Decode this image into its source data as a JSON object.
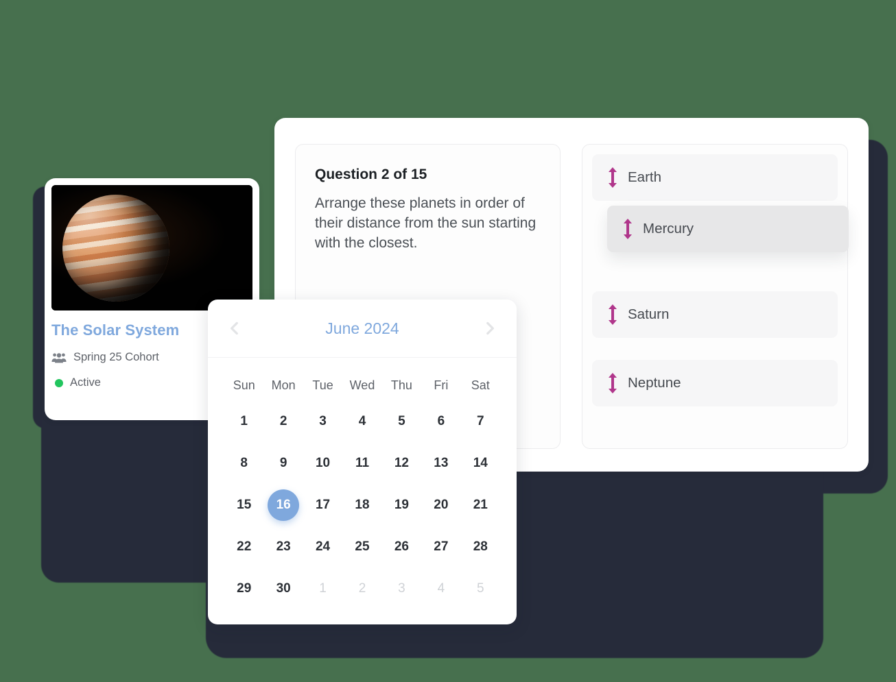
{
  "background": {
    "page_color": "#47704e",
    "shadow_color": "#262b3a"
  },
  "course_card": {
    "title": "The Solar System",
    "cohort_icon": "users-icon",
    "cohort": "Spring 25 Cohort",
    "status_icon": "status-dot-icon",
    "status": "Active",
    "status_color": "#22c55e",
    "title_color": "#7fa8dd",
    "thumbnail_alt": "Jupiter planet on black background"
  },
  "quiz_card": {
    "question_number": "Question 2 of 15",
    "question_text": "Arrange these planets in order of their distance from the sun starting with the closest.",
    "answers": [
      {
        "label": "Earth",
        "state": "idle",
        "handle_icon": "drag-handle-updown-icon"
      },
      {
        "label": "Mercury",
        "state": "dragging",
        "handle_icon": "drag-handle-updown-icon"
      },
      {
        "label": "Saturn",
        "state": "idle",
        "handle_icon": "drag-handle-updown-icon"
      },
      {
        "label": "Neptune",
        "state": "idle",
        "handle_icon": "drag-handle-updown-icon"
      }
    ],
    "handle_color": "#b0368b"
  },
  "calendar": {
    "prev_icon": "chevron-left-icon",
    "next_icon": "chevron-right-icon",
    "month_label": "June 2024",
    "month_color": "#7fa8dd",
    "weekdays": [
      "Sun",
      "Mon",
      "Tue",
      "Wed",
      "Thu",
      "Fri",
      "Sat"
    ],
    "selected_day": "16",
    "selected_color": "#7fa8dd",
    "weeks": [
      [
        {
          "d": "1",
          "muted": false
        },
        {
          "d": "2",
          "muted": false
        },
        {
          "d": "3",
          "muted": false
        },
        {
          "d": "4",
          "muted": false
        },
        {
          "d": "5",
          "muted": false
        },
        {
          "d": "6",
          "muted": false
        },
        {
          "d": "7",
          "muted": false
        }
      ],
      [
        {
          "d": "8",
          "muted": false
        },
        {
          "d": "9",
          "muted": false
        },
        {
          "d": "10",
          "muted": false
        },
        {
          "d": "11",
          "muted": false
        },
        {
          "d": "12",
          "muted": false
        },
        {
          "d": "13",
          "muted": false
        },
        {
          "d": "14",
          "muted": false
        }
      ],
      [
        {
          "d": "15",
          "muted": false
        },
        {
          "d": "16",
          "muted": false,
          "selected": true
        },
        {
          "d": "17",
          "muted": false
        },
        {
          "d": "18",
          "muted": false
        },
        {
          "d": "19",
          "muted": false
        },
        {
          "d": "20",
          "muted": false
        },
        {
          "d": "21",
          "muted": false
        }
      ],
      [
        {
          "d": "22",
          "muted": false
        },
        {
          "d": "23",
          "muted": false
        },
        {
          "d": "24",
          "muted": false
        },
        {
          "d": "25",
          "muted": false
        },
        {
          "d": "26",
          "muted": false
        },
        {
          "d": "27",
          "muted": false
        },
        {
          "d": "28",
          "muted": false
        }
      ],
      [
        {
          "d": "29",
          "muted": false
        },
        {
          "d": "30",
          "muted": false
        },
        {
          "d": "1",
          "muted": true
        },
        {
          "d": "2",
          "muted": true
        },
        {
          "d": "3",
          "muted": true
        },
        {
          "d": "4",
          "muted": true
        },
        {
          "d": "5",
          "muted": true
        }
      ]
    ]
  }
}
